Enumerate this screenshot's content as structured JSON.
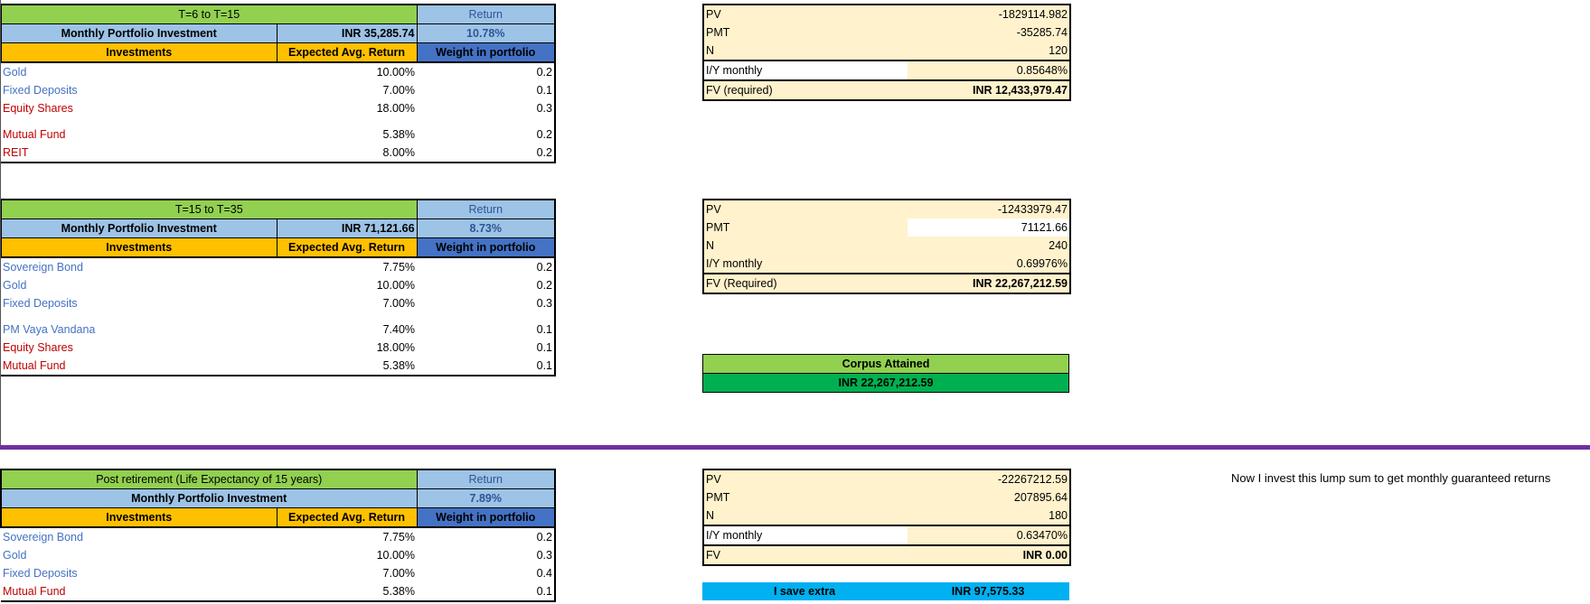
{
  "sections": [
    {
      "period_label": "T=6 to T=15",
      "return_label": "Return",
      "monthly_label": "Monthly Portfolio Investment",
      "monthly_value": "INR 35,285.74",
      "return_value": "10.78%",
      "col_investments": "Investments",
      "col_expected": "Expected Avg. Return",
      "col_weight": "Weight in portfolio",
      "rows": [
        {
          "name": "Gold",
          "ret": "10.00%",
          "weight": "0.2",
          "color": "blue"
        },
        {
          "name": "Fixed Deposits",
          "ret": "7.00%",
          "weight": "0.1",
          "color": "blue"
        },
        {
          "name": "Equity Shares",
          "ret": "18.00%",
          "weight": "0.3",
          "color": "red"
        },
        {
          "name": "Mutual Fund",
          "ret": "5.38%",
          "weight": "0.2",
          "color": "red"
        },
        {
          "name": "REIT",
          "ret": "8.00%",
          "weight": "0.2",
          "color": "red"
        }
      ]
    },
    {
      "period_label": "T=15 to T=35",
      "return_label": "Return",
      "monthly_label": "Monthly Portfolio Investment",
      "monthly_value": "INR 71,121.66",
      "return_value": "8.73%",
      "col_investments": "Investments",
      "col_expected": "Expected Avg. Return",
      "col_weight": "Weight in portfolio",
      "rows": [
        {
          "name": "Sovereign Bond",
          "ret": "7.75%",
          "weight": "0.2",
          "color": "blue"
        },
        {
          "name": "Gold",
          "ret": "10.00%",
          "weight": "0.2",
          "color": "blue"
        },
        {
          "name": "Fixed Deposits",
          "ret": "7.00%",
          "weight": "0.3",
          "color": "blue"
        },
        {
          "name": "PM Vaya Vandana",
          "ret": "7.40%",
          "weight": "0.1",
          "color": "blue"
        },
        {
          "name": "Equity Shares",
          "ret": "18.00%",
          "weight": "0.1",
          "color": "red"
        },
        {
          "name": "Mutual Fund",
          "ret": "5.38%",
          "weight": "0.1",
          "color": "red"
        }
      ]
    },
    {
      "period_label": "Post retirement (Life Expectancy of 15 years)",
      "return_label": "Return",
      "monthly_label": "Monthly Portfolio Investment",
      "monthly_value": "",
      "return_value": "7.89%",
      "col_investments": "Investments",
      "col_expected": "Expected Avg. Return",
      "col_weight": "Weight in portfolio",
      "rows": [
        {
          "name": "Sovereign Bond",
          "ret": "7.75%",
          "weight": "0.2",
          "color": "blue"
        },
        {
          "name": "Gold",
          "ret": "10.00%",
          "weight": "0.3",
          "color": "blue"
        },
        {
          "name": "Fixed Deposits",
          "ret": "7.00%",
          "weight": "0.4",
          "color": "blue"
        },
        {
          "name": "Mutual Fund",
          "ret": "5.38%",
          "weight": "0.1",
          "color": "red"
        }
      ]
    }
  ],
  "tvm": [
    {
      "pv_label": "PV",
      "pv": "-1829114.982",
      "pmt_label": "PMT",
      "pmt": "-35285.74",
      "n_label": "N",
      "n": "120",
      "iy_label": "I/Y monthly",
      "iy": "0.85648%",
      "fv_label": "FV (required)",
      "fv": "INR 12,433,979.47"
    },
    {
      "pv_label": "PV",
      "pv": "-12433979.47",
      "pmt_label": "PMT",
      "pmt": "71121.66",
      "n_label": "N",
      "n": "240",
      "iy_label": "I/Y monthly",
      "iy": "0.69976%",
      "fv_label": "FV (Required)",
      "fv": "INR 22,267,212.59"
    },
    {
      "pv_label": "PV",
      "pv": "-22267212.59",
      "pmt_label": "PMT",
      "pmt": "207895.64",
      "n_label": "N",
      "n": "180",
      "iy_label": "I/Y monthly",
      "iy": "0.63470%",
      "fv_label": "FV",
      "fv": "INR 0.00"
    }
  ],
  "corpus": {
    "title": "Corpus Attained",
    "value": "INR 22,267,212.59"
  },
  "save": {
    "label": "I save extra",
    "value": "INR 97,575.33"
  },
  "note": "Now I invest this lump sum to get monthly guaranteed returns",
  "colors": {
    "green": "#92d050",
    "light_blue": "#9dc3e6",
    "orange": "#ffc000",
    "blue": "#4472c4",
    "cream": "#fff2cc",
    "purple": "#7030a0",
    "cyan": "#00b0f0",
    "dark_green": "#00b050"
  }
}
